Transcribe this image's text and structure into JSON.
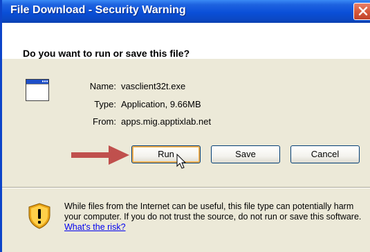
{
  "window": {
    "title": "File Download - Security Warning"
  },
  "prompt": {
    "question": "Do you want to run or save this file?"
  },
  "file": {
    "icon": "application-window-icon",
    "name_label": "Name:",
    "name_value": "vasclient32t.exe",
    "type_label": "Type:",
    "type_value": "Application, 9.66MB",
    "from_label": "From:",
    "from_value": "apps.mig.apptixlab.net"
  },
  "buttons": {
    "run": "Run",
    "save": "Save",
    "cancel": "Cancel"
  },
  "warning": {
    "icon": "security-shield-icon",
    "text": "While files from the Internet can be useful, this file type can potentially harm your computer. If you do not trust the source, do not run or save this software.",
    "link": "What's the risk?"
  },
  "colors": {
    "titlebar": "#0a4fd8",
    "dialog_bg": "#ece9d8",
    "annotation_arrow": "#c0504d",
    "close_button": "#d65a3c",
    "link": "#0000ee"
  }
}
